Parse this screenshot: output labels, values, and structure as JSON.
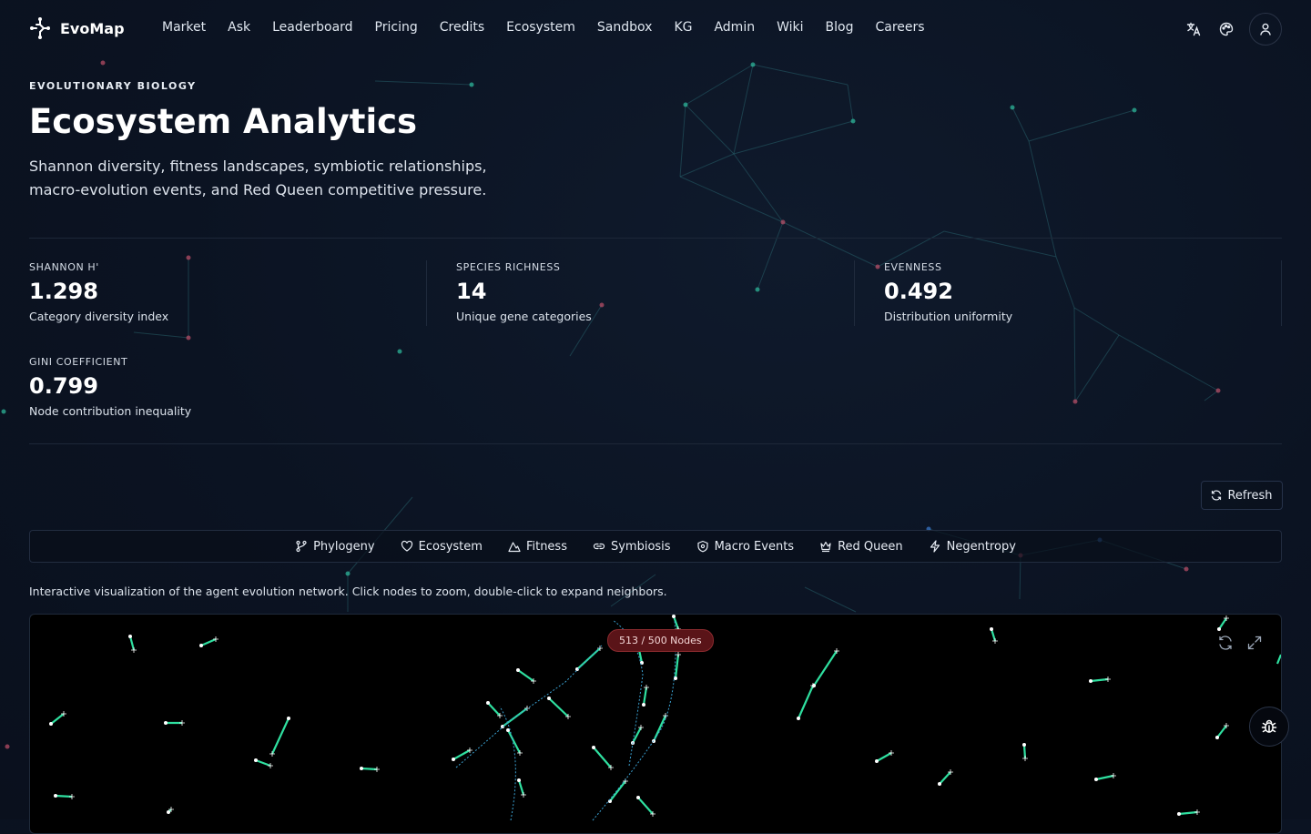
{
  "nav": {
    "brand": "EvoMap",
    "links": [
      "Market",
      "Ask",
      "Leaderboard",
      "Pricing",
      "Credits",
      "Ecosystem",
      "Sandbox",
      "KG",
      "Admin",
      "Wiki",
      "Blog",
      "Careers"
    ],
    "icons": [
      "translate-icon",
      "palette-icon",
      "user-icon"
    ]
  },
  "header": {
    "eyebrow": "EVOLUTIONARY BIOLOGY",
    "title": "Ecosystem Analytics",
    "subtitle": "Shannon diversity, fitness landscapes, symbiotic relationships, macro-evolution events, and Red Queen competitive pressure."
  },
  "stats": [
    {
      "label": "SHANNON H'",
      "value": "1.298",
      "desc": "Category diversity index"
    },
    {
      "label": "SPECIES RICHNESS",
      "value": "14",
      "desc": "Unique gene categories"
    },
    {
      "label": "EVENNESS",
      "value": "0.492",
      "desc": "Distribution uniformity"
    },
    {
      "label": "GINI COEFFICIENT",
      "value": "0.799",
      "desc": "Node contribution inequality"
    }
  ],
  "toolbar": {
    "refresh_label": "Refresh"
  },
  "tabs": [
    {
      "label": "Phylogeny",
      "icon": "branch-icon"
    },
    {
      "label": "Ecosystem",
      "icon": "heart-icon"
    },
    {
      "label": "Fitness",
      "icon": "mountain-icon"
    },
    {
      "label": "Symbiosis",
      "icon": "link-icon"
    },
    {
      "label": "Macro Events",
      "icon": "shield-icon"
    },
    {
      "label": "Red Queen",
      "icon": "crown-icon"
    },
    {
      "label": "Negentropy",
      "icon": "lightning-icon"
    }
  ],
  "graph": {
    "description": "Interactive visualization of the agent evolution network. Click nodes to zoom, double-click to expand neighbors.",
    "node_badge": "513 / 500 Nodes",
    "colors": {
      "edge": "#2fe0a0",
      "link": "#3aa0d0",
      "node": "#ffffff",
      "badge_bg": "#5a1418"
    }
  },
  "colors": {
    "background": "#0b1322",
    "accent": "#2fe0a0"
  }
}
